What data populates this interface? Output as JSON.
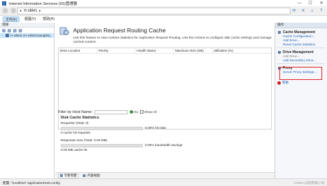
{
  "window": {
    "title": "Internet Information Services (IIS)管理器",
    "controls": [
      "—",
      "☐",
      "✕"
    ]
  },
  "address": {
    "segments": [
      "▸",
      "H-18841",
      "▸"
    ]
  },
  "menu": {
    "items": [
      "文件(F)",
      "视图(V)",
      "帮助(H)"
    ]
  },
  "connections": {
    "header": "连接",
    "node_label": "H-18841 (H-18841\\wangfeiq"
  },
  "feature": {
    "title": "Application Request Routing Cache",
    "description": "Use this feature to view runtime statistics for Application Request Routing. Use the Actions to configure disk cache settings and manage cached content."
  },
  "grid": {
    "columns": [
      "Drive Location",
      "Priority",
      "Health Status",
      "Maximum Size (GB)",
      "Utilization (%)"
    ]
  },
  "filter": {
    "label": "Filter by Host Name:",
    "go_label": "Go",
    "show_all_label": "Show All"
  },
  "stats": {
    "title": "Disk Cache Statistics",
    "requests_label": "Requests (Total: 0)",
    "requests_percent_text": "0.00% hit ratio",
    "requests_fraction": 0,
    "requests_note": "0 cache hit requests",
    "response_label": "Response Size (Total: 0.00 MB)",
    "response_percent_text": "0.00% bandwidth savings",
    "response_fraction": 0,
    "response_note": "0.00 MB cache hit"
  },
  "view_tabs": [
    "功能视图",
    "内容视图"
  ],
  "actions": {
    "header": "操作",
    "sections": [
      {
        "title": "Cache Management",
        "links": [
          "Cache Configuration...",
          "Add Drive...",
          "Reset Cache Statistics"
        ]
      },
      {
        "title": "Drive Management",
        "links": [
          "Add Drive...",
          "Add Secondary Drive..."
        ]
      },
      {
        "title": "Proxy",
        "links": [
          "Server Proxy Settings..."
        ]
      }
    ],
    "help_label": "帮助"
  },
  "status": {
    "text": "配置: \"localhost\" applicationHost.config",
    "watermark": "CSDN @程序猿小何"
  },
  "colors": {
    "accent": "#1a5fb4",
    "highlight": "#e02020",
    "selection": "#cce8ff"
  }
}
